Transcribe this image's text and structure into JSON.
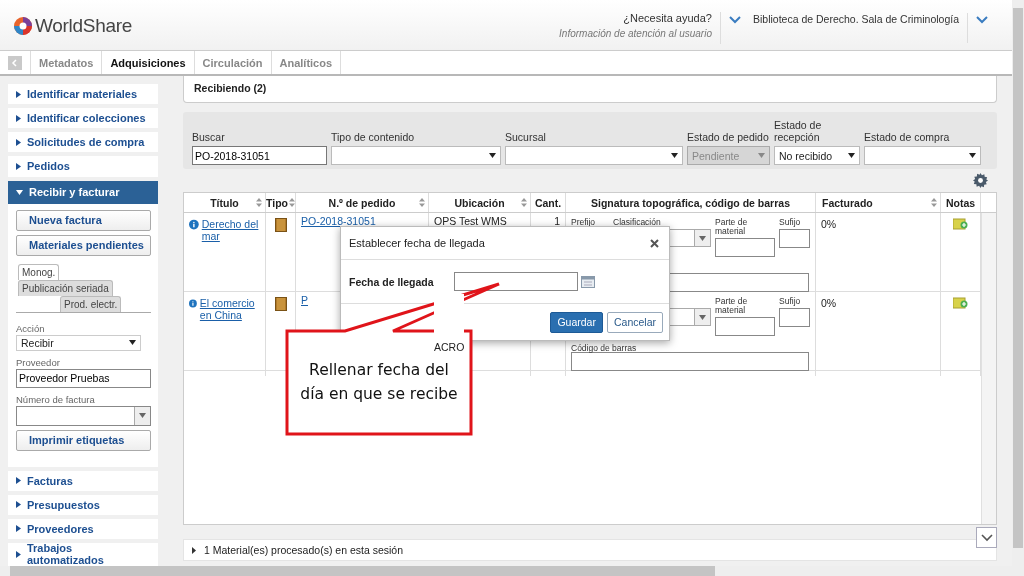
{
  "header": {
    "logo_text": "WorldShare",
    "help": {
      "title": "¿Necesita ayuda?",
      "subtitle": "Información de atención al usuario"
    },
    "library": "Biblioteca de Derecho. Sala de Criminología"
  },
  "tabs": [
    {
      "label": "Metadatos",
      "selected": false
    },
    {
      "label": "Adquisiciones",
      "selected": true
    },
    {
      "label": "Circulación",
      "selected": false
    },
    {
      "label": "Analíticos",
      "selected": false
    }
  ],
  "sidebar": {
    "items": [
      {
        "label": "Identificar materiales",
        "expanded": false
      },
      {
        "label": "Identificar colecciones",
        "expanded": false
      },
      {
        "label": "Solicitudes de compra",
        "expanded": false
      },
      {
        "label": "Pedidos",
        "expanded": false
      },
      {
        "label": "Recibir y facturar",
        "expanded": true
      },
      {
        "label": "Facturas",
        "expanded": false
      },
      {
        "label": "Presupuestos",
        "expanded": false
      },
      {
        "label": "Proveedores",
        "expanded": false
      },
      {
        "label": "Trabajos automatizados",
        "expanded": false
      }
    ],
    "panel": {
      "buttons": [
        "Nueva factura",
        "Materiales pendientes"
      ],
      "subtabs": [
        {
          "label": "Monog.",
          "selected": true
        },
        {
          "label": "Publicación seriada",
          "selected": false
        },
        {
          "label": "Prod. electr.",
          "selected": false
        }
      ],
      "action": {
        "label": "Acción",
        "value": "Recibir"
      },
      "vendor": {
        "label": "Proveedor",
        "value": "Proveedor Pruebas"
      },
      "invoice": {
        "label": "Número de factura"
      },
      "print_button": "Imprimir etiquetas"
    }
  },
  "main": {
    "title": "Recibiendo (2)",
    "filters": [
      {
        "label": "Buscar",
        "kind": "text",
        "value": "PO-2018-31051"
      },
      {
        "label": "Tipo de contenido",
        "kind": "select",
        "disabled": false
      },
      {
        "label": "Sucursal",
        "kind": "select",
        "disabled": false
      },
      {
        "label": "Estado de pedido",
        "kind": "select",
        "value": "Pendiente",
        "disabled": true
      },
      {
        "label": "Estado de recepción",
        "kind": "select",
        "value": "No recibido",
        "disabled": false
      },
      {
        "label": "Estado de compra",
        "kind": "select",
        "disabled": false
      }
    ],
    "table": {
      "columns": [
        {
          "label": "Título",
          "sortable": true
        },
        {
          "label": "Tipo",
          "sortable": true
        },
        {
          "label": "N.º de pedido",
          "sortable": true
        },
        {
          "label": "Ubicación",
          "sortable": true
        },
        {
          "label": "Cant.",
          "sortable": false
        },
        {
          "label": "Signatura topográfica, código de barras",
          "sortable": false
        },
        {
          "label": "Facturado",
          "sortable": true
        },
        {
          "label": "Notas",
          "sortable": false
        }
      ],
      "rows": [
        {
          "title": "Derecho del mar",
          "order": "PO-2018-31051",
          "location": "OPS Test WMS",
          "quantity": "1",
          "signature": {
            "prefix_label": "Prefijo",
            "class_label": "Clasificación",
            "part_label": "Parte de material",
            "suffix_label": "Sufijo"
          },
          "billed": "0%"
        },
        {
          "title": "El comercio en China",
          "order": "P",
          "location": "ACRO",
          "signature": {
            "part_label": "Parte de material",
            "suffix_label": "Sufijo",
            "barcode_label": "Código de barras"
          },
          "billed": "0%"
        }
      ]
    },
    "footer": "1 Material(es) procesado(s) en esta sesión"
  },
  "dialog": {
    "title": "Establecer fecha de llegada",
    "field_label": "Fecha de llegada",
    "buttons": [
      {
        "label": "Guardar",
        "kind": "primary"
      },
      {
        "label": "Cancelar",
        "kind": "secondary"
      }
    ]
  },
  "callout": {
    "text": "Rellenar fecha del día en que se recibe"
  }
}
